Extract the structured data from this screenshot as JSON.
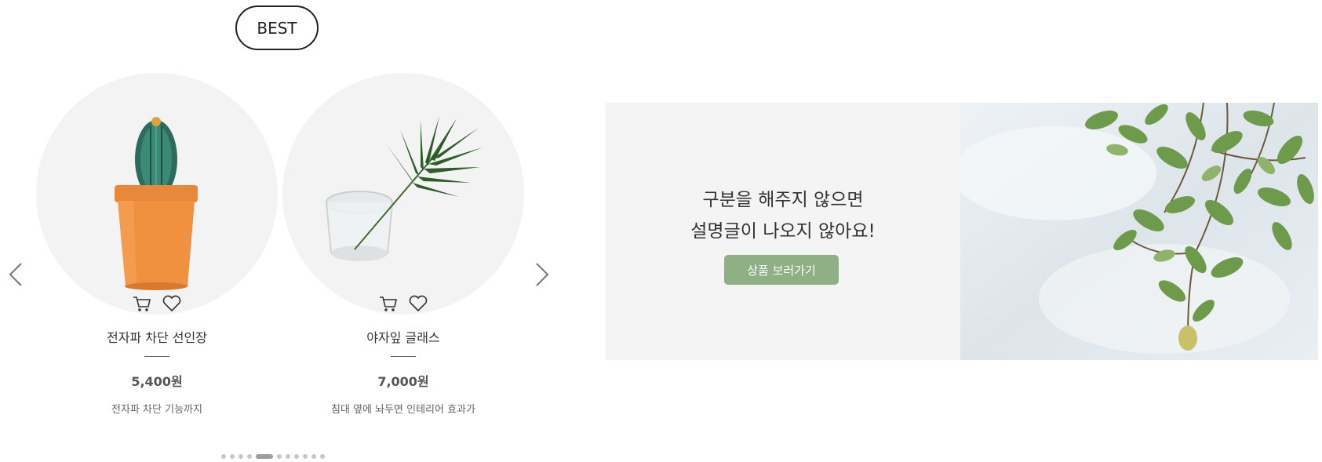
{
  "header": {
    "badge_label": "BEST"
  },
  "carousel": {
    "prev_icon": "chevron-left-icon",
    "next_icon": "chevron-right-icon",
    "products": [
      {
        "image": "cactus-in-orange-pot",
        "name": "전자파 차단 선인장",
        "price": "5,400원",
        "description": "전자파 차단 기능까지"
      },
      {
        "image": "palm-leaf-in-glass",
        "name": "야자잎 글래스",
        "price": "7,000원",
        "description": "침대 옆에 놔두면 인테리어 효과가"
      }
    ],
    "actions": [
      "cart-icon",
      "heart-icon"
    ],
    "pagination": {
      "total": 11,
      "active_index": 4
    }
  },
  "promo": {
    "line1": "구분을 해주지 않으면",
    "line2": "설명글이 나오지 않아요!",
    "button_label": "상품 보러가기",
    "image": "hanging-green-leaves-photo",
    "button_color": "#8fb084"
  }
}
